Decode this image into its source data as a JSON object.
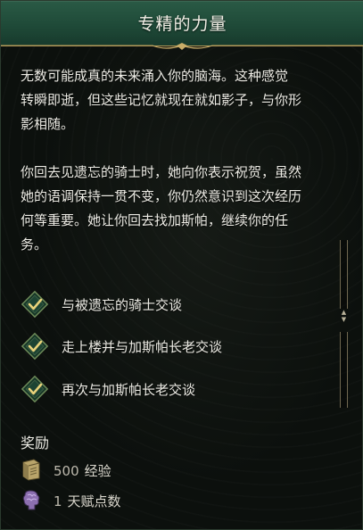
{
  "title": "专精的力量",
  "story": {
    "lines": [
      "无数可能成真的未来涌入你的脑海。这种感觉",
      "转瞬即逝，但这些记忆就现在就如影子，与你形",
      "影相随。",
      "你回去见遗忘的骑士时，她向你表示祝贺，虽然",
      "她的语调保持一贯不变，你仍然意识到这次经历",
      "何等重要。她让你回去找加斯帕，继续你的任",
      "务。"
    ]
  },
  "objectives": [
    {
      "label": "与被遗忘的骑士交谈",
      "completed": true
    },
    {
      "label": "走上楼并与加斯帕长老交谈",
      "completed": true
    },
    {
      "label": "再次与加斯帕长老交谈",
      "completed": true
    }
  ],
  "rewards": {
    "heading": "奖励",
    "items": [
      {
        "amount": "500",
        "label": "经验",
        "icon": "experience-book-icon"
      },
      {
        "amount": "1",
        "label": "天赋点数",
        "icon": "talent-brain-icon"
      }
    ]
  },
  "colors": {
    "title_bar": "#1f4a38",
    "gold_trim": "#b59a59",
    "check": "#e8d27a",
    "text": "#ecebe4"
  }
}
